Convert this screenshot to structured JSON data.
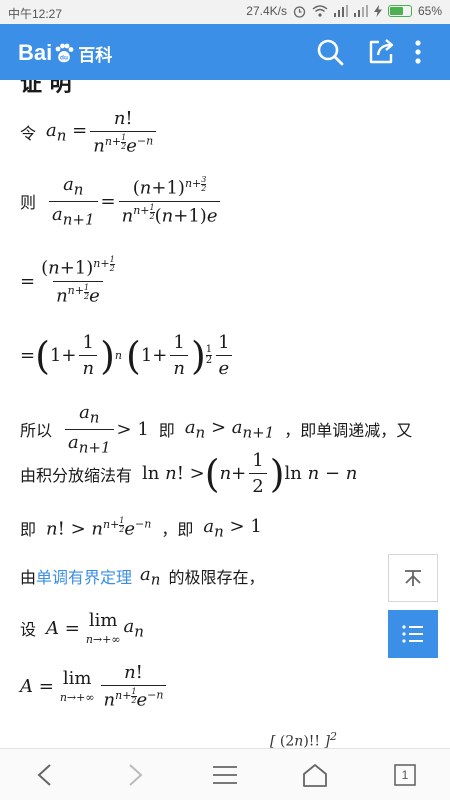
{
  "status_bar": {
    "time": "中午12:27",
    "speed": "27.4K/s",
    "battery_percent": 65,
    "battery_label": "65%"
  },
  "app_bar": {
    "logo_text_left": "Bai",
    "logo_text_right": "百科",
    "icons": [
      "search-icon",
      "share-icon",
      "more-icon"
    ]
  },
  "article": {
    "cut_heading": "证 明",
    "ling": "令",
    "ze": "则",
    "suoyi": "所以",
    "ji": "即",
    "monotone_text": "，即单调递减，又",
    "integral_text": "由积分放缩法有",
    "ji2": "即",
    "ji3": "，即",
    "you": "由",
    "theorem_link": "单调有界定理",
    "limit_exists": "的极限存在，",
    "she": "设"
  },
  "floating": {
    "top_icon": "back-to-top-icon",
    "menu_icon": "list-icon"
  },
  "bottom_nav": {
    "items": [
      "back-icon",
      "forward-icon",
      "menu-icon",
      "home-icon",
      "tabs-icon"
    ],
    "tab_count": "1"
  },
  "colors": {
    "accent": "#3b8fe7",
    "battery": "#4caf50"
  }
}
